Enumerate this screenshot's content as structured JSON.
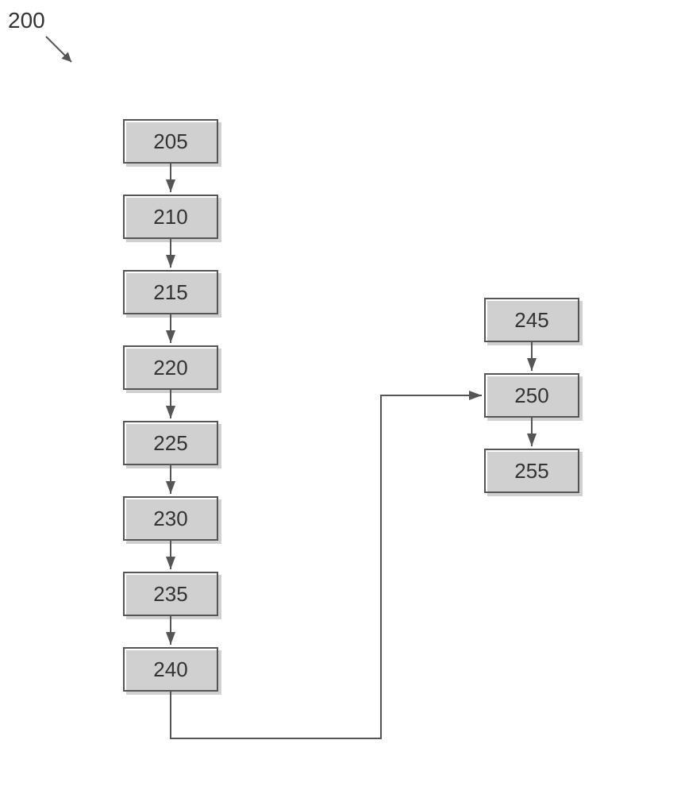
{
  "figure": {
    "label": "200"
  },
  "left_column": {
    "boxes": [
      {
        "id": "205",
        "label": "205"
      },
      {
        "id": "210",
        "label": "210"
      },
      {
        "id": "215",
        "label": "215"
      },
      {
        "id": "220",
        "label": "220"
      },
      {
        "id": "225",
        "label": "225"
      },
      {
        "id": "230",
        "label": "230"
      },
      {
        "id": "235",
        "label": "235"
      },
      {
        "id": "240",
        "label": "240"
      }
    ]
  },
  "right_column": {
    "boxes": [
      {
        "id": "245",
        "label": "245"
      },
      {
        "id": "250",
        "label": "250"
      },
      {
        "id": "255",
        "label": "255"
      }
    ]
  }
}
